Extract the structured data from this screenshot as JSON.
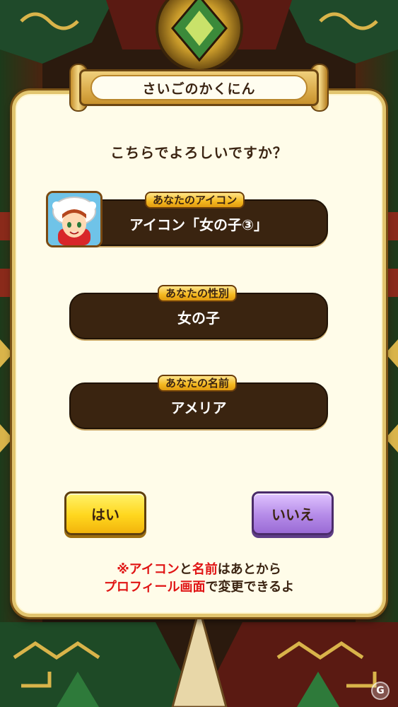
{
  "dialog": {
    "title": "さいごのかくにん",
    "question": "こちらでよろしいですか？"
  },
  "fields": {
    "icon": {
      "tag": "あなたのアイコン",
      "value": "アイコン「女の子③」"
    },
    "gender": {
      "tag": "あなたの性別",
      "value": "女の子"
    },
    "name": {
      "tag": "あなたの名前",
      "value": "アメリア"
    }
  },
  "buttons": {
    "yes": "はい",
    "no": "いいえ"
  },
  "note": {
    "line1": [
      {
        "text": "※アイコン",
        "red": true
      },
      {
        "text": "と",
        "red": false
      },
      {
        "text": "名前",
        "red": true
      },
      {
        "text": "はあとから",
        "red": false
      }
    ],
    "line2": [
      {
        "text": "プロフィール画面",
        "red": true
      },
      {
        "text": "で変更できるよ",
        "red": false
      }
    ]
  },
  "colors": {
    "yes_button": "#ffd71e",
    "no_button": "#b58be8",
    "field_bg": "#3a2410",
    "dialog_bg": "#fffce9",
    "highlight_red": "#e01414"
  },
  "icons": {
    "watermark": "gamer-logo-icon",
    "avatar": "girl-avatar-icon"
  }
}
